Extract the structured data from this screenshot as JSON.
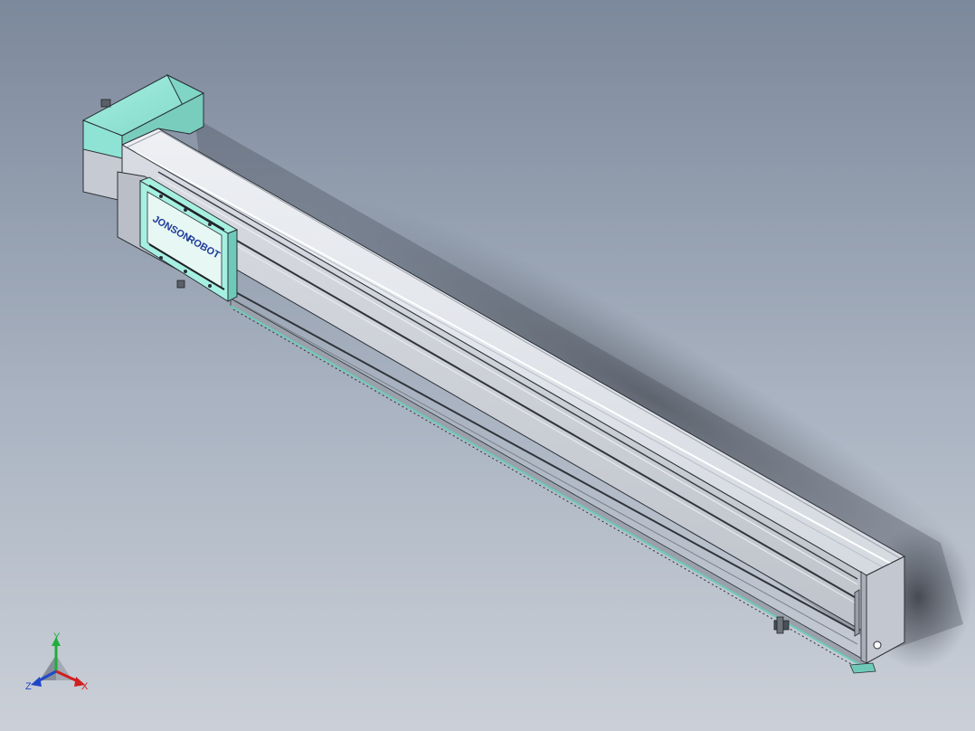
{
  "app": {
    "view": "isometric",
    "background_top": "#7f8c9f",
    "background_bottom": "#c9cfd7"
  },
  "model": {
    "name_hint": "linear actuator module",
    "colors": {
      "profile_light": "#dfe2e8",
      "profile_mid": "#c2c6ce",
      "profile_dark": "#8b9099",
      "edge": "#2b2f36",
      "accent_teal": "#8fe3d4",
      "accent_teal_dark": "#5fb8a8",
      "logo_blue": "#1e3a9a"
    },
    "carriage_logo": "ROBOT",
    "carriage_logo_prefix": "JONSON"
  },
  "triad": {
    "x_label": "X",
    "y_label": "Y",
    "z_label": "Z",
    "x_color": "#d11f1f",
    "y_color": "#1fae3a",
    "z_color": "#2147c9"
  }
}
